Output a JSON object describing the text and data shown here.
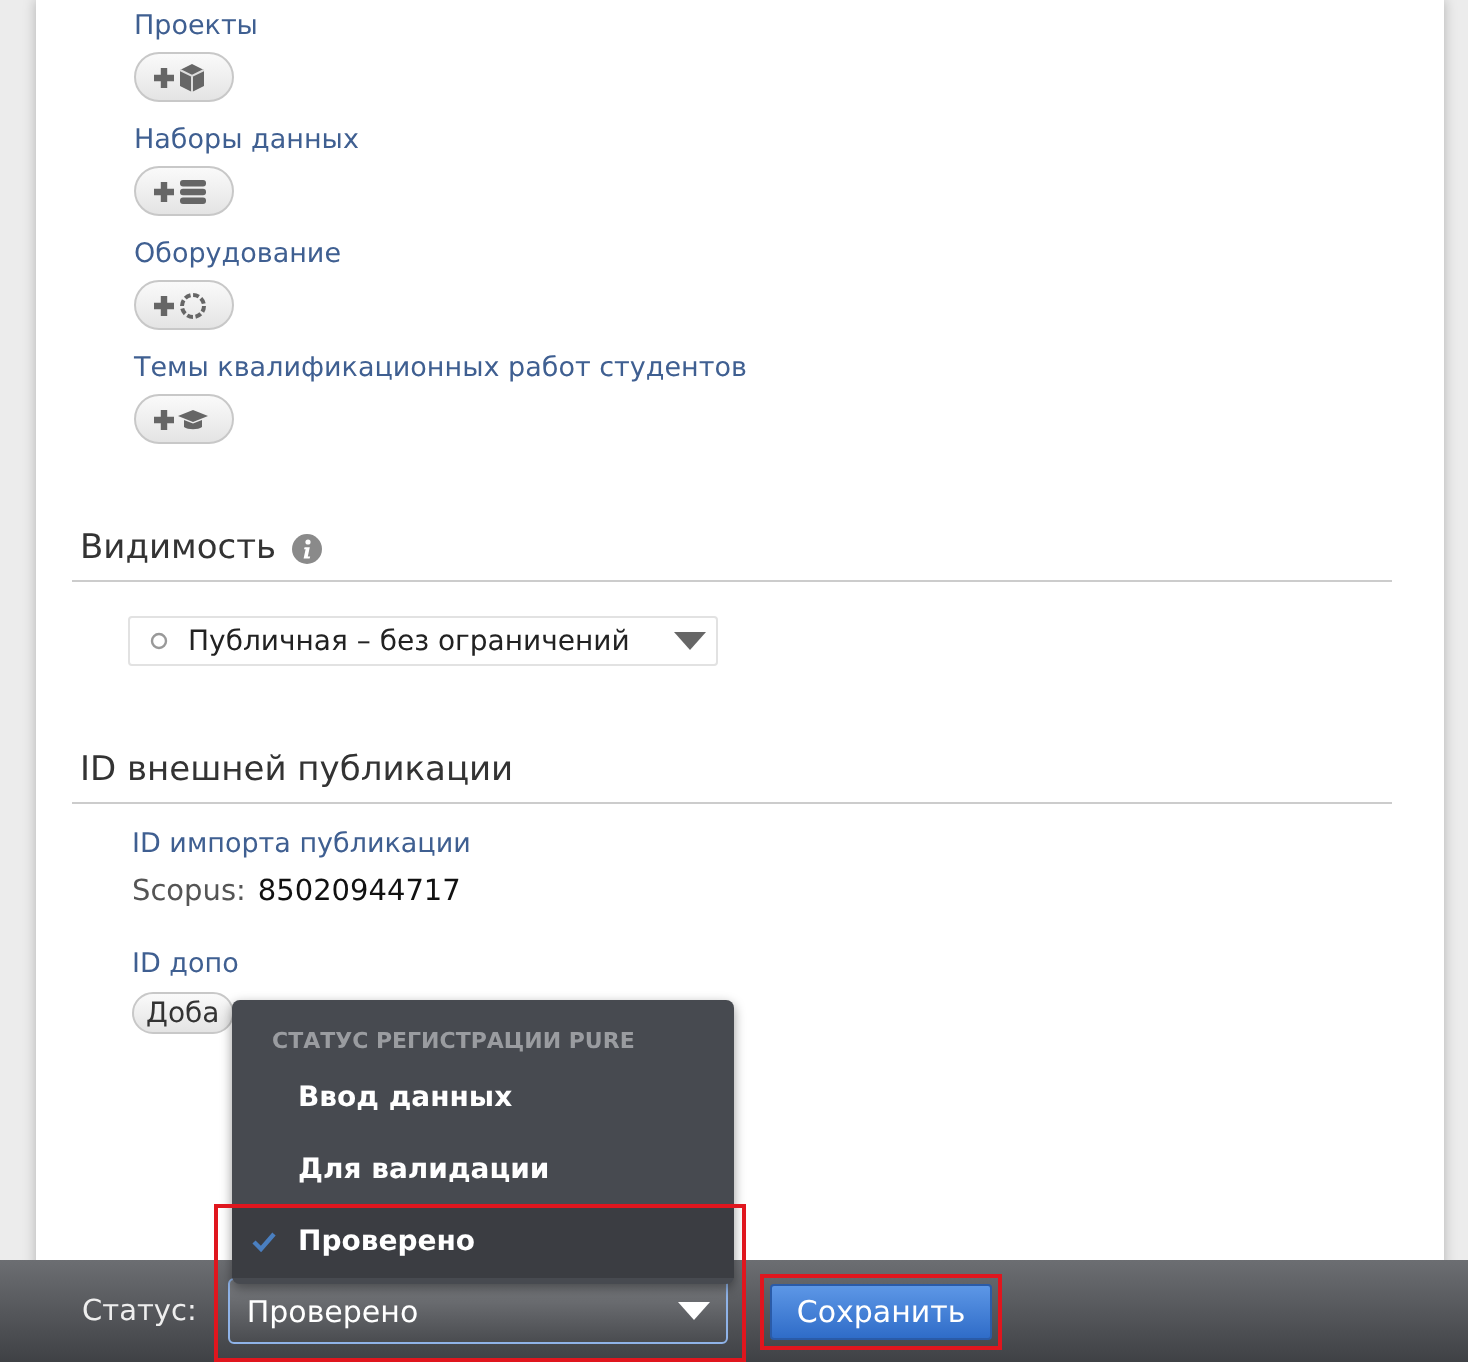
{
  "relations": [
    {
      "label": "Проекты",
      "kind": "cube"
    },
    {
      "label": "Наборы данных",
      "kind": "stack"
    },
    {
      "label": "Оборудование",
      "kind": "ring"
    },
    {
      "label": "Темы квалификационных работ студентов",
      "kind": "cap"
    }
  ],
  "visibility": {
    "heading": "Видимость",
    "value": "Публичная – без ограничений"
  },
  "external_id": {
    "heading": "ID внешней публикации",
    "import_label": "ID импорта публикации",
    "source": "Scopus:",
    "id": "85020944717",
    "extra_label": "ID допо",
    "add_button": "Доба"
  },
  "status_menu": {
    "heading": "СТАТУС РЕГИСТРАЦИИ PURE",
    "items": [
      {
        "label": "Ввод данных",
        "selected": false
      },
      {
        "label": "Для валидации",
        "selected": false
      },
      {
        "label": "Проверено",
        "selected": true
      }
    ]
  },
  "footer": {
    "status_label": "Статус:",
    "status_value": "Проверено",
    "save_button": "Сохранить",
    "status_highlighted": true,
    "save_highlighted": true
  }
}
